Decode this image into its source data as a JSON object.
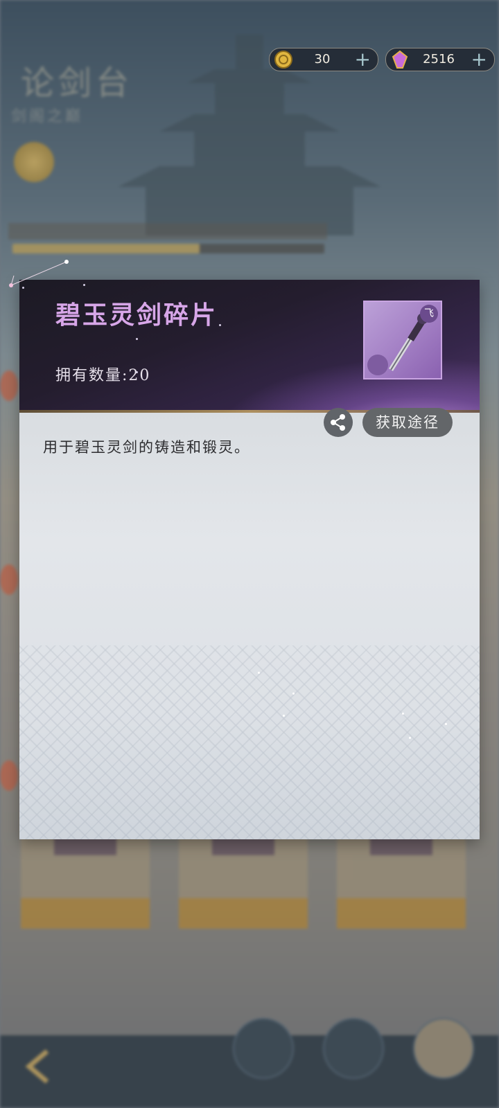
{
  "currency": {
    "jade": {
      "amount": "30",
      "icon": "gold-coin-icon",
      "plus": "+"
    },
    "crystal": {
      "amount": "2516",
      "icon": "purple-crystal-icon",
      "plus": "+"
    }
  },
  "popup": {
    "item_name": "碧玉灵剑碎片",
    "owned_label": "拥有数量:20",
    "item_icon": "jade-sword-fragment-icon",
    "item_badge": "飞",
    "description": "用于碧玉灵剑的铸造和锻灵。",
    "share_icon": "share-icon",
    "source_button": "获取途径"
  },
  "colors": {
    "item_name": "#d7a6e8",
    "header_bg": "#241d2e",
    "body_bg": "#e3e6ea",
    "button_bg": "#636669"
  }
}
